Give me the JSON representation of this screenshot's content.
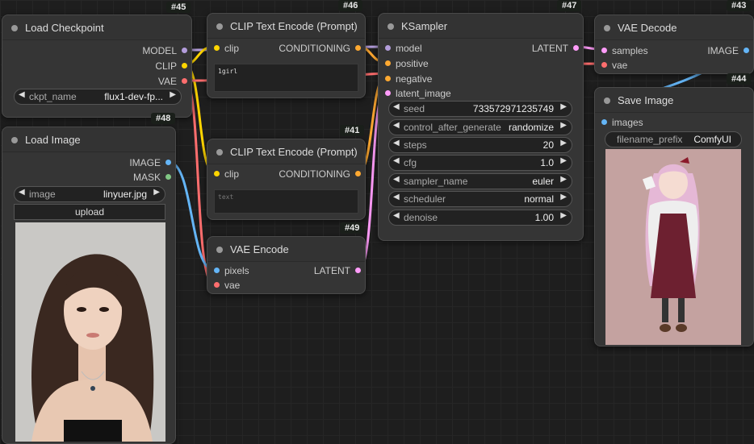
{
  "nodes": {
    "load_checkpoint": {
      "id": "#45",
      "title": "Load Checkpoint",
      "outputs": [
        "MODEL",
        "CLIP",
        "VAE"
      ],
      "widget": {
        "label": "ckpt_name",
        "value": "flux1-dev-fp..."
      }
    },
    "load_image": {
      "id": "#48",
      "title": "Load Image",
      "outputs": [
        "IMAGE",
        "MASK"
      ],
      "widget": {
        "label": "image",
        "value": "linyuer.jpg"
      },
      "upload_label": "upload"
    },
    "clip_text_encode_1": {
      "id": "#46",
      "title": "CLIP Text Encode (Prompt)",
      "input": "clip",
      "output": "CONDITIONING",
      "text": "1girl"
    },
    "clip_text_encode_2": {
      "id": "#41",
      "title": "CLIP Text Encode (Prompt)",
      "input": "clip",
      "output": "CONDITIONING",
      "placeholder": "text"
    },
    "vae_encode": {
      "id": "#49",
      "title": "VAE Encode",
      "inputs": [
        "pixels",
        "vae"
      ],
      "output": "LATENT"
    },
    "ksampler": {
      "id": "#47",
      "title": "KSampler",
      "inputs": [
        "model",
        "positive",
        "negative",
        "latent_image"
      ],
      "output": "LATENT",
      "widgets": [
        {
          "label": "seed",
          "value": "733572971235749"
        },
        {
          "label": "control_after_generate",
          "value": "randomize"
        },
        {
          "label": "steps",
          "value": "20"
        },
        {
          "label": "cfg",
          "value": "1.0"
        },
        {
          "label": "sampler_name",
          "value": "euler"
        },
        {
          "label": "scheduler",
          "value": "normal"
        },
        {
          "label": "denoise",
          "value": "1.00"
        }
      ]
    },
    "vae_decode": {
      "id": "#43",
      "title": "VAE Decode",
      "inputs": [
        "samples",
        "vae"
      ],
      "output": "IMAGE"
    },
    "save_image": {
      "id": "#44",
      "title": "Save Image",
      "input": "images",
      "widget": {
        "label": "filename_prefix",
        "value": "ComfyUI"
      }
    }
  },
  "colors": {
    "model": "#b39ddb",
    "clip": "#ffd500",
    "vae": "#ff6e6e",
    "conditioning": "#ffa931",
    "latent": "#ff9cf9",
    "image": "#64b5f6",
    "mask": "#81c784"
  }
}
